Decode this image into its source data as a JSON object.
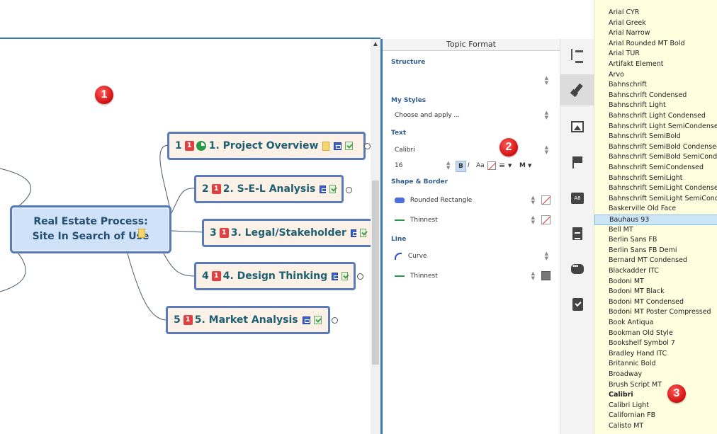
{
  "map": {
    "central_title_line1": "Real Estate Process:",
    "central_title_line2": "Site In Search of Use",
    "topics": [
      {
        "num": "1",
        "badge": "1",
        "label": "1. Project Overview"
      },
      {
        "num": "2",
        "badge": "1",
        "label": "2. S-E-L Analysis"
      },
      {
        "num": "3",
        "badge": "1",
        "label": "3. Legal/Stakeholder"
      },
      {
        "num": "4",
        "badge": "1",
        "label": "4. Design Thinking"
      },
      {
        "num": "5",
        "badge": "1",
        "label": "5. Market Analysis"
      }
    ]
  },
  "callouts": {
    "c1": "1",
    "c2": "2",
    "c3": "3"
  },
  "panel": {
    "title": "Topic Format",
    "structure_label": "Structure",
    "mystyles_label": "My Styles",
    "mystyles_value": "Choose and apply ...",
    "text_label": "Text",
    "font_value": "Calibri",
    "size_value": "16",
    "bold_btn": "B",
    "italic_btn": "I",
    "case_btn": "Aa",
    "align_btn": "≡",
    "more_btn": "M",
    "shape_label": "Shape & Border",
    "shape_value": "Rounded Rectangle",
    "border_value": "Thinnest",
    "line_label": "Line",
    "line_shape_value": "Curve",
    "line_weight_value": "Thinnest",
    "icons": {
      "spin": "spinner-icon",
      "nofill": "no-fill-color-icon"
    }
  },
  "rail": {
    "icons": [
      "structure-icon",
      "format-brush-icon",
      "image-icon",
      "flag-icon",
      "label-icon",
      "notes-icon",
      "comments-icon",
      "task-icon"
    ]
  },
  "fontlist": {
    "items": [
      "Arial CYR",
      "Arial Greek",
      "Arial Narrow",
      "Arial Rounded MT Bold",
      "Arial TUR",
      "Artifakt Element",
      "Arvo",
      "Bahnschrift",
      "Bahnschrift Condensed",
      "Bahnschrift Light",
      "Bahnschrift Light Condensed",
      "Bahnschrift Light SemiCondensed",
      "Bahnschrift SemiBold",
      "Bahnschrift SemiBold Condensed",
      "Bahnschrift SemiBold SemiConden",
      "Bahnschrift SemiCondensed",
      "Bahnschrift SemiLight",
      "Bahnschrift SemiLight Condensed",
      "Bahnschrift SemiLight SemiConde",
      "Baskerville Old Face",
      "Bauhaus 93",
      "Bell MT",
      "Berlin Sans FB",
      "Berlin Sans FB Demi",
      "Bernard MT Condensed",
      "Blackadder ITC",
      "Bodoni MT",
      "Bodoni MT Black",
      "Bodoni MT Condensed",
      "Bodoni MT Poster Compressed",
      "Book Antiqua",
      "Bookman Old Style",
      "Bookshelf Symbol 7",
      "Bradley Hand ITC",
      "Britannic Bold",
      "Broadway",
      "Brush Script MT",
      "Calibri",
      "Calibri Light",
      "Californian FB",
      "Calisto MT"
    ],
    "selected": "Bauhaus 93",
    "current": "Calibri"
  }
}
